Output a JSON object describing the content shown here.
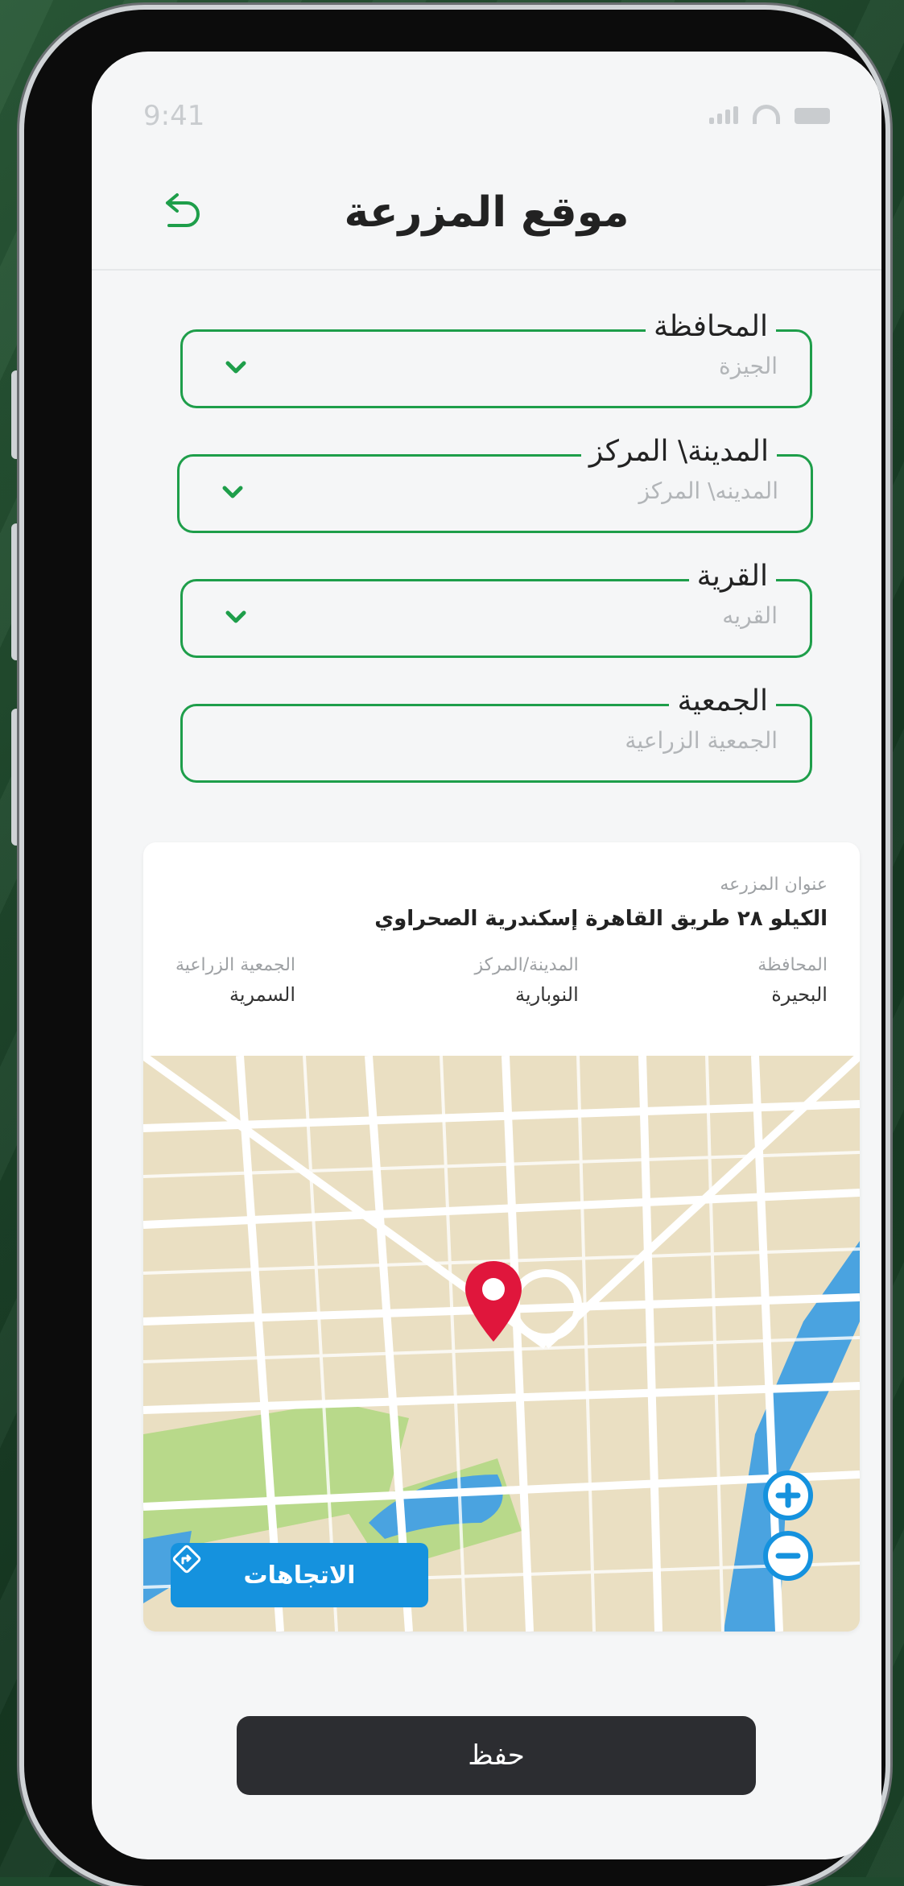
{
  "status": {
    "time": "9:41"
  },
  "header": {
    "title": "موقع المزرعة"
  },
  "form": {
    "fields": [
      {
        "label": "المحافظة",
        "value": "الجيزة",
        "has_dropdown": true
      },
      {
        "label": "المدينة\\ المركز",
        "value": "المدينه\\ المركز",
        "has_dropdown": true
      },
      {
        "label": "القرية",
        "value": "القريه",
        "has_dropdown": true
      },
      {
        "label": "الجمعية",
        "value": "الجمعية الزراعية",
        "has_dropdown": false
      }
    ]
  },
  "card": {
    "address_label": "عنوان المزرعه",
    "address_value": "الكيلو ٢٨ طريق القاهرة إسكندرية الصحراوي",
    "details": [
      {
        "key": "المحافظة",
        "value": "البحيرة"
      },
      {
        "key": "المدينة/المركز",
        "value": "النوبارية"
      },
      {
        "key": "الجمعية الزراعية",
        "value": "السمرية"
      }
    ]
  },
  "map": {
    "directions_label": "الاتجاهات",
    "zoom_in_icon": "plus-icon",
    "zoom_out_icon": "minus-icon",
    "pin_icon": "location-pin-icon"
  },
  "actions": {
    "save_label": "حفظ"
  },
  "colors": {
    "accent_green": "#1e9e4a",
    "map_blue": "#1592de",
    "pin_red": "#e0163c",
    "button_dark": "#2c2d31"
  }
}
